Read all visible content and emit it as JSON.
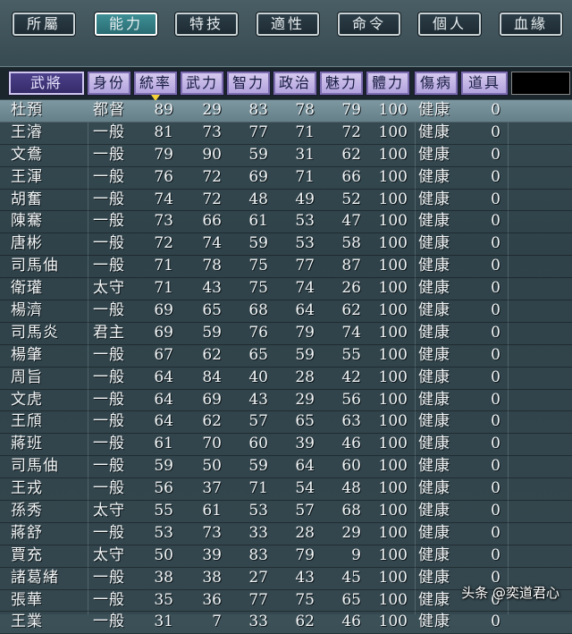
{
  "tabs": [
    "所屬",
    "能力",
    "特技",
    "適性",
    "命令",
    "個人",
    "血緣"
  ],
  "active_tab_index": 1,
  "headers": [
    "武將",
    "身份",
    "統率",
    "武力",
    "智力",
    "政治",
    "魅力",
    "體力",
    "傷病",
    "道具"
  ],
  "sort_column_index": 2,
  "selected_row_index": 0,
  "rows": [
    {
      "name": "杜預",
      "rank": "都督",
      "lead": "89",
      "war": "29",
      "int": "83",
      "pol": "78",
      "chr": "79",
      "hp": "100",
      "sick": "健康",
      "item": "0"
    },
    {
      "name": "王濬",
      "rank": "一般",
      "lead": "81",
      "war": "73",
      "int": "77",
      "pol": "71",
      "chr": "72",
      "hp": "100",
      "sick": "健康",
      "item": "0"
    },
    {
      "name": "文鴦",
      "rank": "一般",
      "lead": "79",
      "war": "90",
      "int": "59",
      "pol": "31",
      "chr": "62",
      "hp": "100",
      "sick": "健康",
      "item": "0"
    },
    {
      "name": "王渾",
      "rank": "一般",
      "lead": "76",
      "war": "72",
      "int": "69",
      "pol": "71",
      "chr": "66",
      "hp": "100",
      "sick": "健康",
      "item": "0"
    },
    {
      "name": "胡奮",
      "rank": "一般",
      "lead": "74",
      "war": "72",
      "int": "48",
      "pol": "49",
      "chr": "52",
      "hp": "100",
      "sick": "健康",
      "item": "0"
    },
    {
      "name": "陳騫",
      "rank": "一般",
      "lead": "73",
      "war": "66",
      "int": "61",
      "pol": "53",
      "chr": "47",
      "hp": "100",
      "sick": "健康",
      "item": "0"
    },
    {
      "name": "唐彬",
      "rank": "一般",
      "lead": "72",
      "war": "74",
      "int": "59",
      "pol": "53",
      "chr": "58",
      "hp": "100",
      "sick": "健康",
      "item": "0"
    },
    {
      "name": "司馬伷",
      "rank": "一般",
      "lead": "71",
      "war": "78",
      "int": "75",
      "pol": "77",
      "chr": "87",
      "hp": "100",
      "sick": "健康",
      "item": "0"
    },
    {
      "name": "衛瓘",
      "rank": "太守",
      "lead": "71",
      "war": "43",
      "int": "75",
      "pol": "74",
      "chr": "26",
      "hp": "100",
      "sick": "健康",
      "item": "0"
    },
    {
      "name": "楊濟",
      "rank": "一般",
      "lead": "69",
      "war": "65",
      "int": "68",
      "pol": "64",
      "chr": "62",
      "hp": "100",
      "sick": "健康",
      "item": "0"
    },
    {
      "name": "司馬炎",
      "rank": "君主",
      "lead": "69",
      "war": "59",
      "int": "76",
      "pol": "79",
      "chr": "74",
      "hp": "100",
      "sick": "健康",
      "item": "0"
    },
    {
      "name": "楊肇",
      "rank": "一般",
      "lead": "67",
      "war": "62",
      "int": "65",
      "pol": "59",
      "chr": "55",
      "hp": "100",
      "sick": "健康",
      "item": "0"
    },
    {
      "name": "周旨",
      "rank": "一般",
      "lead": "64",
      "war": "84",
      "int": "40",
      "pol": "28",
      "chr": "42",
      "hp": "100",
      "sick": "健康",
      "item": "0"
    },
    {
      "name": "文虎",
      "rank": "一般",
      "lead": "64",
      "war": "69",
      "int": "43",
      "pol": "29",
      "chr": "56",
      "hp": "100",
      "sick": "健康",
      "item": "0"
    },
    {
      "name": "王頎",
      "rank": "一般",
      "lead": "64",
      "war": "62",
      "int": "57",
      "pol": "65",
      "chr": "63",
      "hp": "100",
      "sick": "健康",
      "item": "0"
    },
    {
      "name": "蔣班",
      "rank": "一般",
      "lead": "61",
      "war": "70",
      "int": "60",
      "pol": "39",
      "chr": "46",
      "hp": "100",
      "sick": "健康",
      "item": "0"
    },
    {
      "name": "司馬伷",
      "rank": "一般",
      "lead": "59",
      "war": "50",
      "int": "59",
      "pol": "64",
      "chr": "60",
      "hp": "100",
      "sick": "健康",
      "item": "0"
    },
    {
      "name": "王戎",
      "rank": "一般",
      "lead": "56",
      "war": "37",
      "int": "71",
      "pol": "54",
      "chr": "48",
      "hp": "100",
      "sick": "健康",
      "item": "0"
    },
    {
      "name": "孫秀",
      "rank": "太守",
      "lead": "55",
      "war": "61",
      "int": "53",
      "pol": "57",
      "chr": "68",
      "hp": "100",
      "sick": "健康",
      "item": "0"
    },
    {
      "name": "蔣舒",
      "rank": "一般",
      "lead": "53",
      "war": "73",
      "int": "33",
      "pol": "28",
      "chr": "29",
      "hp": "100",
      "sick": "健康",
      "item": "0"
    },
    {
      "name": "賈充",
      "rank": "太守",
      "lead": "50",
      "war": "39",
      "int": "83",
      "pol": "79",
      "chr": "9",
      "hp": "100",
      "sick": "健康",
      "item": "0"
    },
    {
      "name": "諸葛緒",
      "rank": "一般",
      "lead": "38",
      "war": "38",
      "int": "27",
      "pol": "43",
      "chr": "45",
      "hp": "100",
      "sick": "健康",
      "item": "0"
    },
    {
      "name": "張華",
      "rank": "一般",
      "lead": "35",
      "war": "36",
      "int": "77",
      "pol": "75",
      "chr": "65",
      "hp": "100",
      "sick": "健康",
      "item": "0"
    },
    {
      "name": "王業",
      "rank": "一般",
      "lead": "31",
      "war": "7",
      "int": "33",
      "pol": "62",
      "chr": "46",
      "hp": "100",
      "sick": "健康",
      "item": "0"
    }
  ],
  "watermark": "头条 @奕道君心"
}
